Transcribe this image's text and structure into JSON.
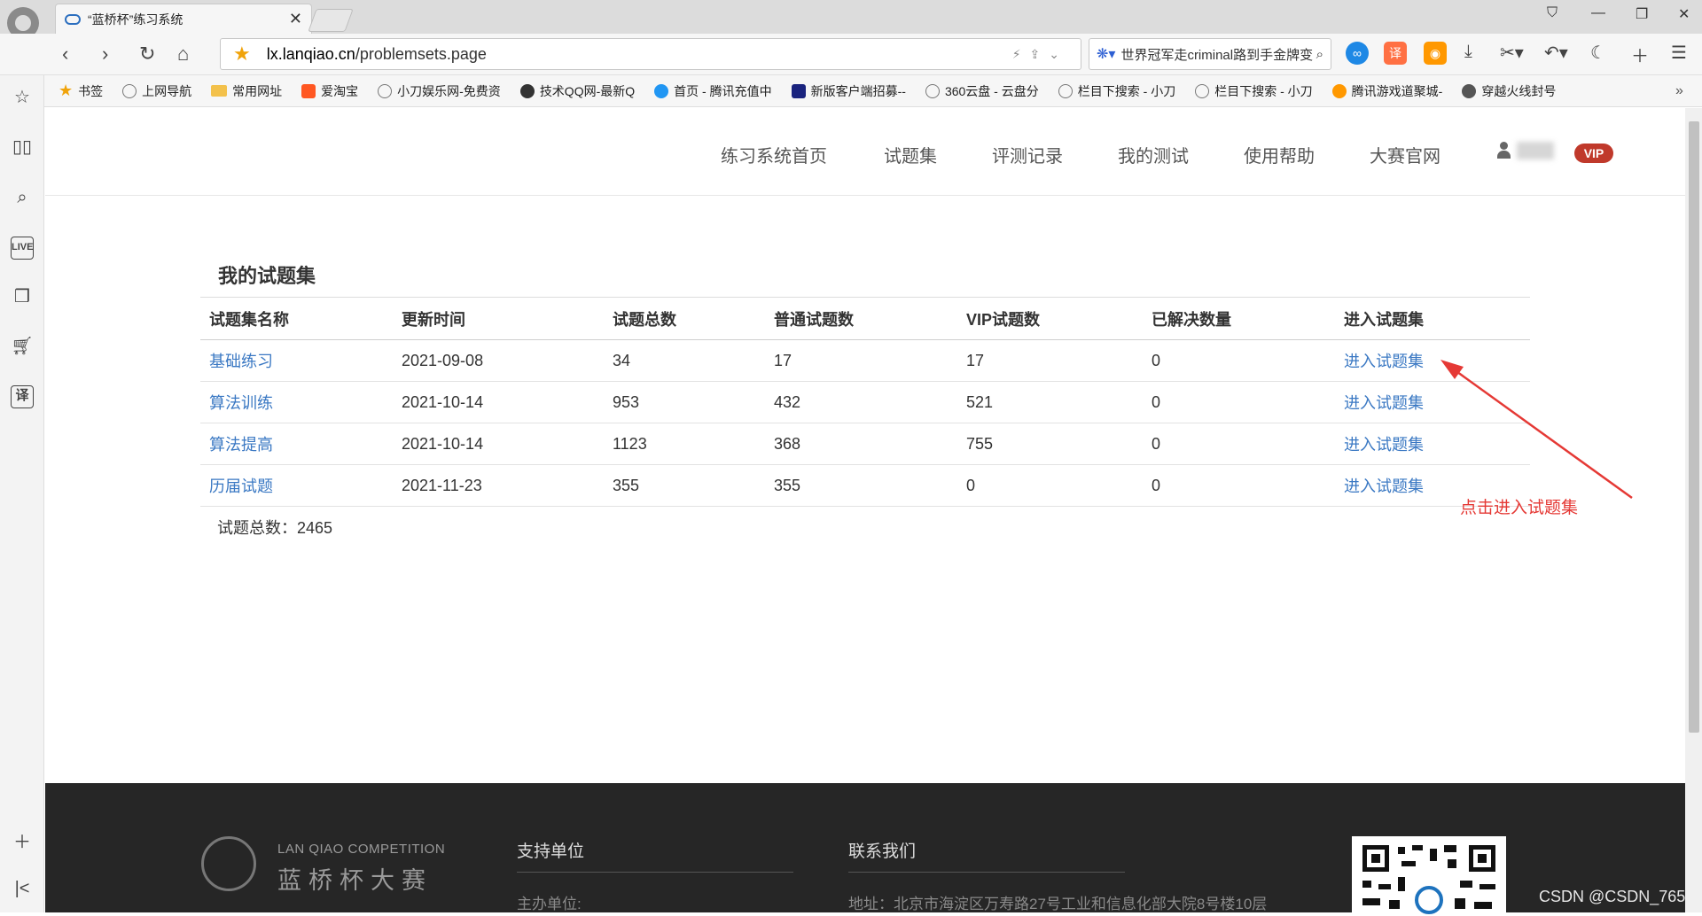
{
  "browser": {
    "tab_title": "“蓝桥杯”练习系统",
    "url_host": "lx.lanqiao.cn",
    "url_path": "/problemsets.page",
    "search_text": "世界冠军走criminal路到手金牌变",
    "bookmarks": [
      "书签",
      "上网导航",
      "常用网址",
      "爱淘宝",
      "小刀娱乐网-免费资",
      "技术QQ网-最新Q",
      "首页 - 腾讯充值中",
      "新版客户端招募--",
      "360云盘 - 云盘分",
      "栏目下搜索 - 小刀",
      "栏目下搜索 - 小刀",
      "腾讯游戏道聚城-",
      "穿越火线封号"
    ],
    "ext_translate": "译"
  },
  "sidebar": {
    "live_label": "LIVE",
    "translate_label": "译"
  },
  "site_nav": {
    "items": [
      "练习系统首页",
      "试题集",
      "评测记录",
      "我的测试",
      "使用帮助",
      "大赛官网"
    ],
    "vip": "VIP"
  },
  "problemsets": {
    "title": "我的试题集",
    "columns": [
      "试题集名称",
      "更新时间",
      "试题总数",
      "普通试题数",
      "VIP试题数",
      "已解决数量",
      "进入试题集"
    ],
    "rows": [
      {
        "name": "基础练习",
        "updated": "2021-09-08",
        "total": "34",
        "normal": "17",
        "vip": "17",
        "solved": "0",
        "action": "进入试题集"
      },
      {
        "name": "算法训练",
        "updated": "2021-10-14",
        "total": "953",
        "normal": "432",
        "vip": "521",
        "solved": "0",
        "action": "进入试题集"
      },
      {
        "name": "算法提高",
        "updated": "2021-10-14",
        "total": "1123",
        "normal": "368",
        "vip": "755",
        "solved": "0",
        "action": "进入试题集"
      },
      {
        "name": "历届试题",
        "updated": "2021-11-23",
        "total": "355",
        "normal": "355",
        "vip": "0",
        "solved": "0",
        "action": "进入试题集"
      }
    ],
    "total_label": "试题总数：2465"
  },
  "annotation": {
    "text": "点击进入试题集",
    "color": "#e53935"
  },
  "footer": {
    "logo_en": "LAN QIAO COMPETITION",
    "logo_cn": "蓝桥杯大赛",
    "support_title": "支持单位",
    "support_text": "主办单位:",
    "contact_title": "联系我们",
    "contact_text": "地址：北京市海淀区万寿路27号工业和信息化部大院8号楼10层"
  },
  "watermark": "CSDN @CSDN_765",
  "colors": {
    "link": "#3a78c3",
    "vip_badge": "#c0392b",
    "footer_bg": "#262626"
  }
}
